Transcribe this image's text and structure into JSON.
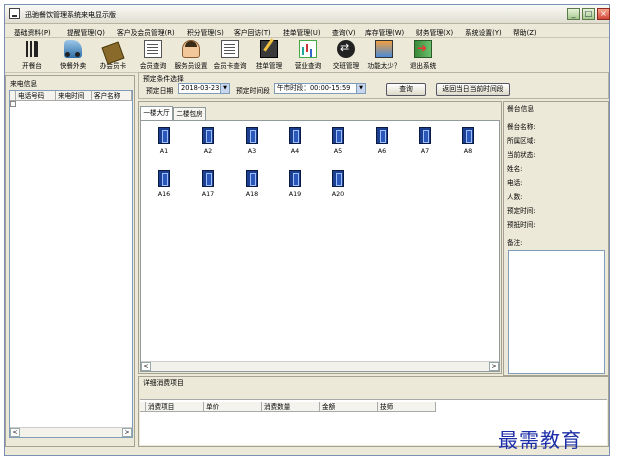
{
  "window": {
    "title": "迅驰餐饮管理系统来电显示版",
    "min": "_",
    "max": "□",
    "close": "×"
  },
  "menu": [
    "基础资料(P)",
    "提醒管理(Q)",
    "客户及会员管理(R)",
    "积分管理(S)",
    "客户回访(T)",
    "挂单管理(U)",
    "查询(V)",
    "库存管理(W)",
    "财务管理(X)",
    "系统设置(Y)",
    "帮助(Z)"
  ],
  "toolbar": [
    {
      "label": "开餐台",
      "icon": "fork-knife-icon"
    },
    {
      "label": "快餐外卖",
      "icon": "motorbike-icon"
    },
    {
      "label": "办会员卡",
      "icon": "member-card-icon"
    },
    {
      "label": "会员查询",
      "icon": "member-query-icon"
    },
    {
      "label": "服务员设置",
      "icon": "waiter-icon"
    },
    {
      "label": "会员卡查询",
      "icon": "card-query-icon"
    },
    {
      "label": "挂单管理",
      "icon": "pending-order-icon"
    },
    {
      "label": "营业查询",
      "icon": "business-chart-icon"
    },
    {
      "label": "交班管理",
      "icon": "shift-exchange-icon"
    },
    {
      "label": "功能太少？",
      "icon": "more-functions-icon"
    },
    {
      "label": "退出系统",
      "icon": "exit-door-icon"
    }
  ],
  "left": {
    "title": "来电信息",
    "columns": [
      "电话号码",
      "来电时间",
      "客户名称"
    ]
  },
  "filter": {
    "title": "预定条件选择",
    "date_label": "预定日期",
    "date_value": "2018-03-23",
    "period_label": "预定时间段",
    "period_value": "午市时段：00:00-15:59",
    "query_button": "查询",
    "return_button": "返回当日当前时间段"
  },
  "tabs": [
    "一楼大厅",
    "二楼包房"
  ],
  "tables_row1": [
    "A1",
    "A2",
    "A3",
    "A4",
    "A5",
    "A6",
    "A7",
    "A8"
  ],
  "tables_row2": [
    "A16",
    "A17",
    "A18",
    "A19",
    "A20"
  ],
  "info": {
    "title": "餐台信息",
    "fields": [
      "餐台名称:",
      "所属区域:",
      "当前状态:",
      "姓名:",
      "电话:",
      "人数:",
      "预定时间:",
      "预抵时间:"
    ],
    "remark": "备注:"
  },
  "detail": {
    "title": "详细消费项目",
    "columns": [
      "消费项目",
      "单价",
      "消费数量",
      "金额",
      "技师"
    ]
  },
  "watermark": "最需教育",
  "scroll": {
    "left": "<",
    "right": ">"
  },
  "colors": {
    "title_bar": "#e0ddd0",
    "window_bg": "#ece9d8",
    "table_icon": "#1d3f8f",
    "watermark": "#1d2fa8"
  }
}
